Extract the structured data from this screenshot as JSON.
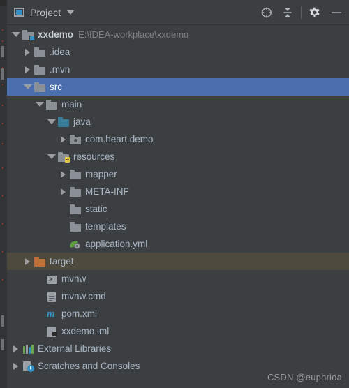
{
  "window": {
    "background": "#3c3f41",
    "selection_color": "#4b6eaf",
    "excluded_row_color": "#4f4a3e"
  },
  "toolbar": {
    "panel_icon": "project-window-icon",
    "title": "Project",
    "dropdown_icon": "chevron-down-icon",
    "buttons": [
      {
        "name": "select-opened-file-button",
        "icon": "crosshair-target-icon"
      },
      {
        "name": "collapse-all-button",
        "icon": "collapse-all-icon"
      },
      {
        "name": "settings-button",
        "icon": "gear-icon"
      },
      {
        "name": "hide-button",
        "icon": "minimize-icon"
      }
    ]
  },
  "tree": {
    "rows": [
      {
        "indent": 0,
        "arrow": "open",
        "icon": "folder-module-icon",
        "label": "xxdemo",
        "bold": true,
        "hint": "E:\\IDEA-workplace\\xxdemo",
        "state": "normal"
      },
      {
        "indent": 1,
        "arrow": "closed",
        "icon": "folder-icon",
        "label": ".idea",
        "bold": false,
        "hint": "",
        "state": "normal"
      },
      {
        "indent": 1,
        "arrow": "closed",
        "icon": "folder-icon",
        "label": ".mvn",
        "bold": false,
        "hint": "",
        "state": "normal"
      },
      {
        "indent": 1,
        "arrow": "open",
        "icon": "folder-icon",
        "label": "src",
        "bold": false,
        "hint": "",
        "state": "selected"
      },
      {
        "indent": 2,
        "arrow": "open",
        "icon": "folder-icon",
        "label": "main",
        "bold": false,
        "hint": "",
        "state": "normal"
      },
      {
        "indent": 3,
        "arrow": "open",
        "icon": "folder-source-root-icon",
        "label": "java",
        "bold": false,
        "hint": "",
        "state": "normal"
      },
      {
        "indent": 4,
        "arrow": "closed",
        "icon": "package-icon",
        "label": "com.heart.demo",
        "bold": false,
        "hint": "",
        "state": "normal"
      },
      {
        "indent": 3,
        "arrow": "open",
        "icon": "folder-resources-root-icon",
        "label": "resources",
        "bold": false,
        "hint": "",
        "state": "normal"
      },
      {
        "indent": 4,
        "arrow": "closed",
        "icon": "folder-icon",
        "label": "mapper",
        "bold": false,
        "hint": "",
        "state": "normal"
      },
      {
        "indent": 4,
        "arrow": "closed",
        "icon": "folder-icon",
        "label": "META-INF",
        "bold": false,
        "hint": "",
        "state": "normal"
      },
      {
        "indent": 4,
        "arrow": "none",
        "icon": "folder-icon",
        "label": "static",
        "bold": false,
        "hint": "",
        "state": "normal"
      },
      {
        "indent": 4,
        "arrow": "none",
        "icon": "folder-icon",
        "label": "templates",
        "bold": false,
        "hint": "",
        "state": "normal"
      },
      {
        "indent": 4,
        "arrow": "none",
        "icon": "spring-yaml-icon",
        "label": "application.yml",
        "bold": false,
        "hint": "",
        "state": "normal"
      },
      {
        "indent": 1,
        "arrow": "closed",
        "icon": "folder-excluded-icon",
        "label": "target",
        "bold": false,
        "hint": "",
        "state": "excluded"
      },
      {
        "indent": 2,
        "arrow": "none",
        "icon": "script-icon",
        "label": "mvnw",
        "bold": false,
        "hint": "",
        "state": "normal"
      },
      {
        "indent": 2,
        "arrow": "none",
        "icon": "file-icon",
        "label": "mvnw.cmd",
        "bold": false,
        "hint": "",
        "state": "normal"
      },
      {
        "indent": 2,
        "arrow": "none",
        "icon": "maven-pom-icon",
        "label": "pom.xml",
        "bold": false,
        "hint": "",
        "state": "normal"
      },
      {
        "indent": 2,
        "arrow": "none",
        "icon": "iml-module-icon",
        "label": "xxdemo.iml",
        "bold": false,
        "hint": "",
        "state": "normal"
      },
      {
        "indent": 0,
        "arrow": "closed",
        "icon": "external-libraries-icon",
        "label": "External Libraries",
        "bold": false,
        "hint": "",
        "state": "normal"
      },
      {
        "indent": 0,
        "arrow": "closed",
        "icon": "scratches-icon",
        "label": "Scratches and Consoles",
        "bold": false,
        "hint": "",
        "state": "normal"
      }
    ]
  },
  "watermark": {
    "text": "CSDN @euphrioa"
  }
}
